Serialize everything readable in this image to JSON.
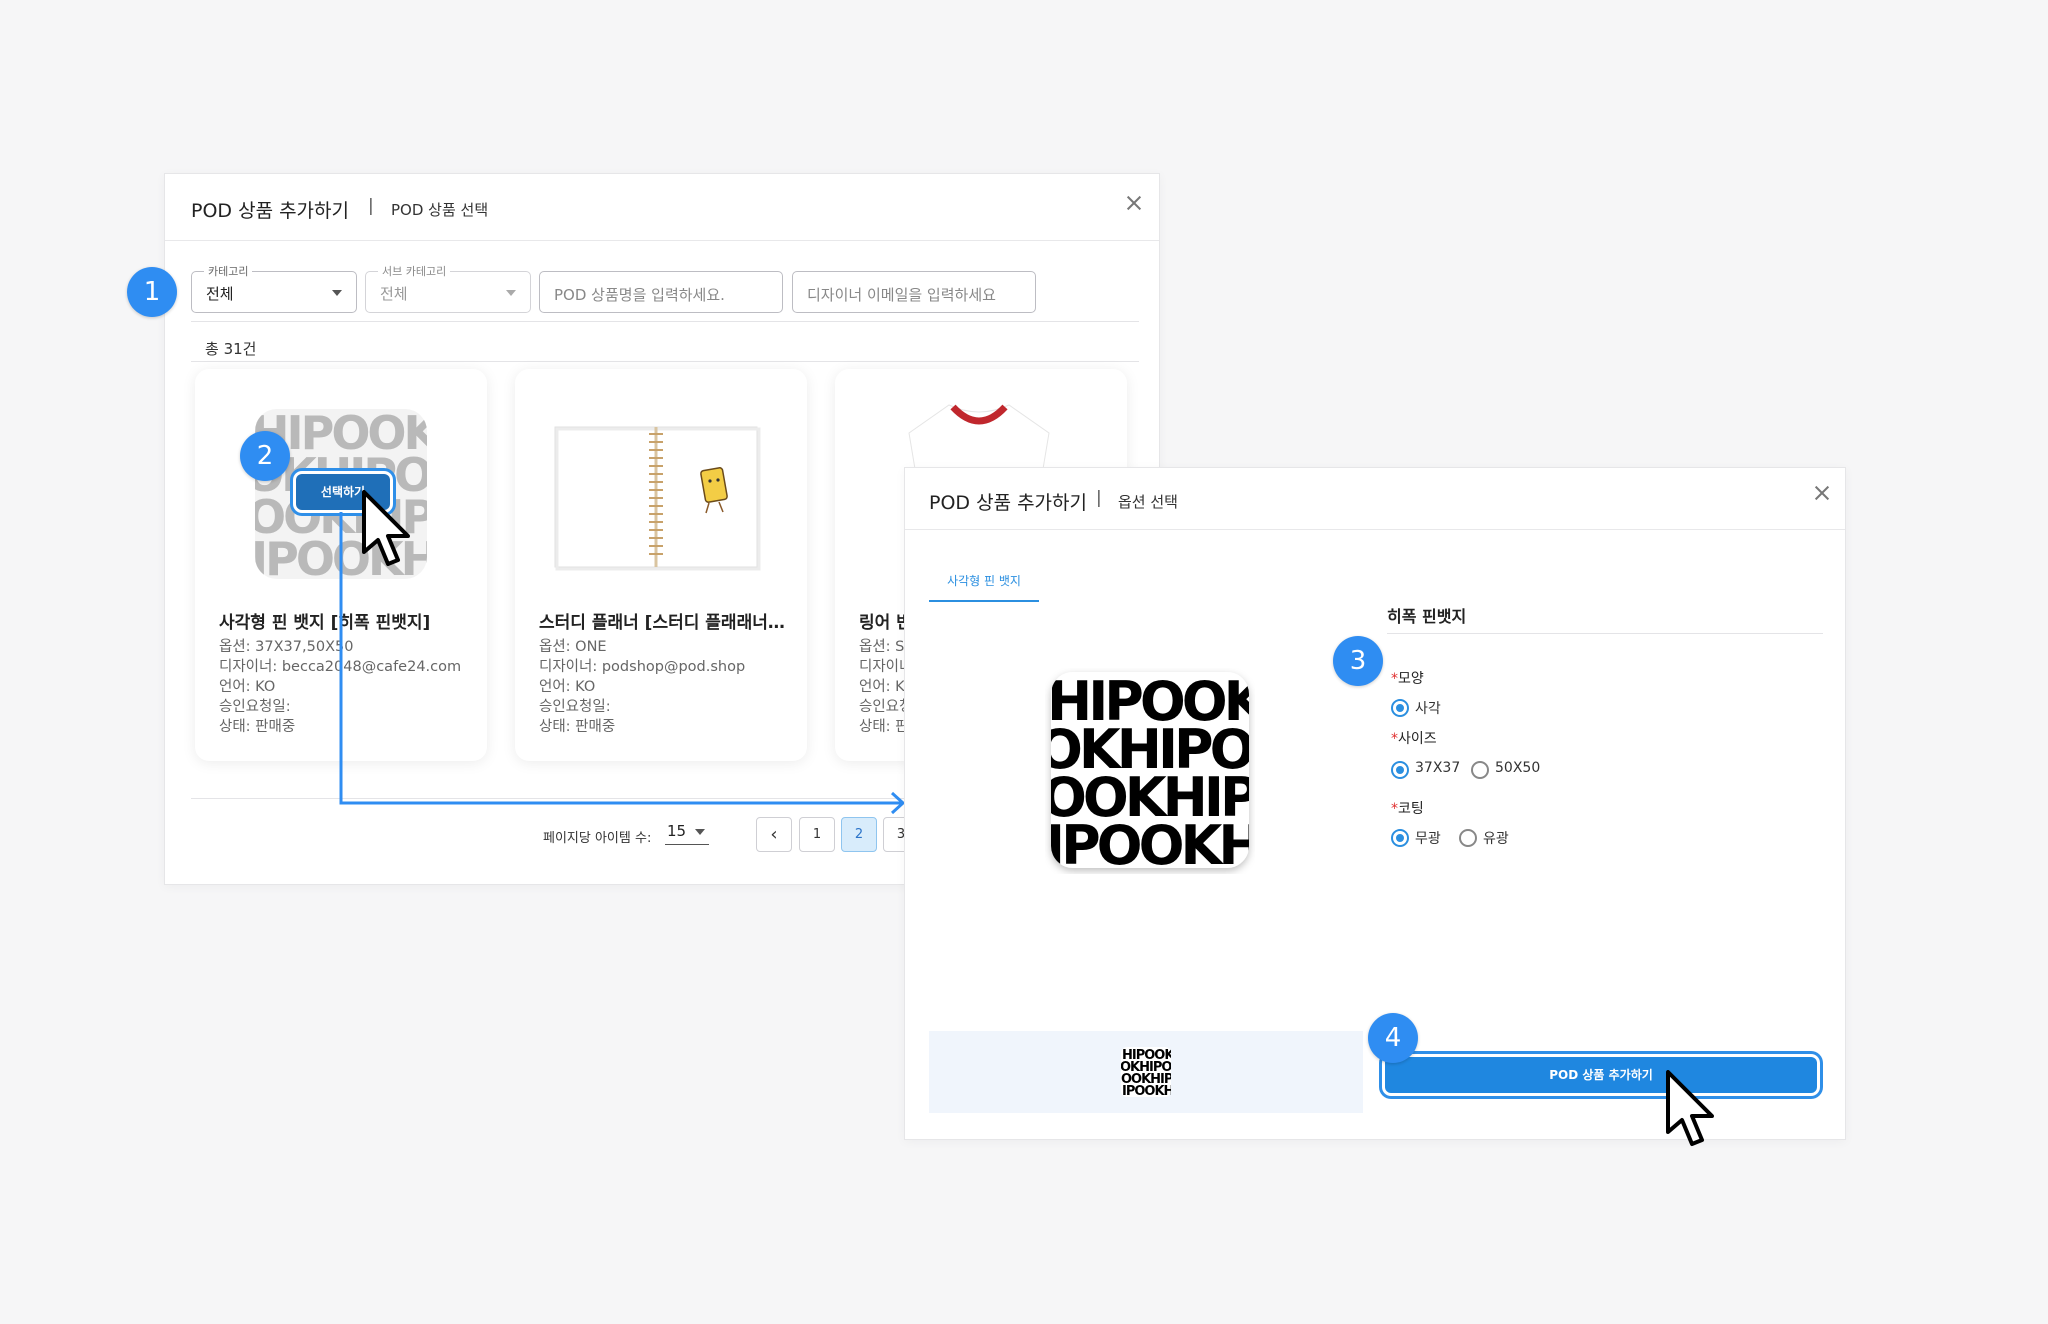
{
  "modal1": {
    "title": "POD 상품 추가하기",
    "separator": "|",
    "subtitle": "POD 상품 선택",
    "filters": {
      "category": {
        "label": "카테고리",
        "value": "전체"
      },
      "subcategory": {
        "label": "서브 카테고리",
        "value": "전체"
      },
      "name_placeholder": "POD 상품명을 입력하세요.",
      "email_placeholder": "디자이너 이메일을 입력하세요"
    },
    "total": "총 31건",
    "cards": [
      {
        "title": "사각형 핀 뱃지 [히폭 핀뱃지]",
        "lines": [
          "옵션: 37X37,50X50",
          "디자이너: becca2048@cafe24.com",
          "언어: KO",
          "승인요청일:",
          "상태: 판매중"
        ]
      },
      {
        "title": "스터디 플래너 [스터디 플래래너…",
        "lines": [
          "옵션: ONE",
          "디자이너: podshop@pod.shop",
          "언어: KO",
          "승인요청일:",
          "상태: 판매중"
        ]
      },
      {
        "title": "링어 반",
        "lines": [
          "옵션: S",
          "디자이너",
          "언어: K",
          "승인요청",
          "상태: 판"
        ]
      }
    ],
    "select_button": "선택하기",
    "pagination": {
      "per_page_label": "페이지당 아이템 수:",
      "per_page_value": "15",
      "prev": "‹",
      "pages": [
        "1",
        "2",
        "3"
      ],
      "active_page": "2"
    }
  },
  "modal2": {
    "title": "POD 상품 추가하기",
    "separator": "|",
    "subtitle": "옵션 선택",
    "tab": "사각형 핀 뱃지",
    "product_name": "히폭 핀뱃지",
    "required_mark": "*",
    "options": {
      "shape": {
        "label": "모양",
        "choices": [
          "사각"
        ],
        "selected": "사각"
      },
      "size": {
        "label": "사이즈",
        "choices": [
          "37X37",
          "50X50"
        ],
        "selected": "37X37"
      },
      "coating": {
        "label": "코팅",
        "choices": [
          "무광",
          "유광"
        ],
        "selected": "무광"
      }
    },
    "add_button": "POD 상품 추가하기"
  },
  "artwork_text": [
    "HIPOOK",
    "OKHIPO",
    "OOKHIP",
    "IPOOKH"
  ],
  "steps": [
    "1",
    "2",
    "3",
    "4"
  ],
  "colors": {
    "accent": "#1f87e0",
    "badge": "#2f8df2",
    "select": "#1f6fb8"
  }
}
